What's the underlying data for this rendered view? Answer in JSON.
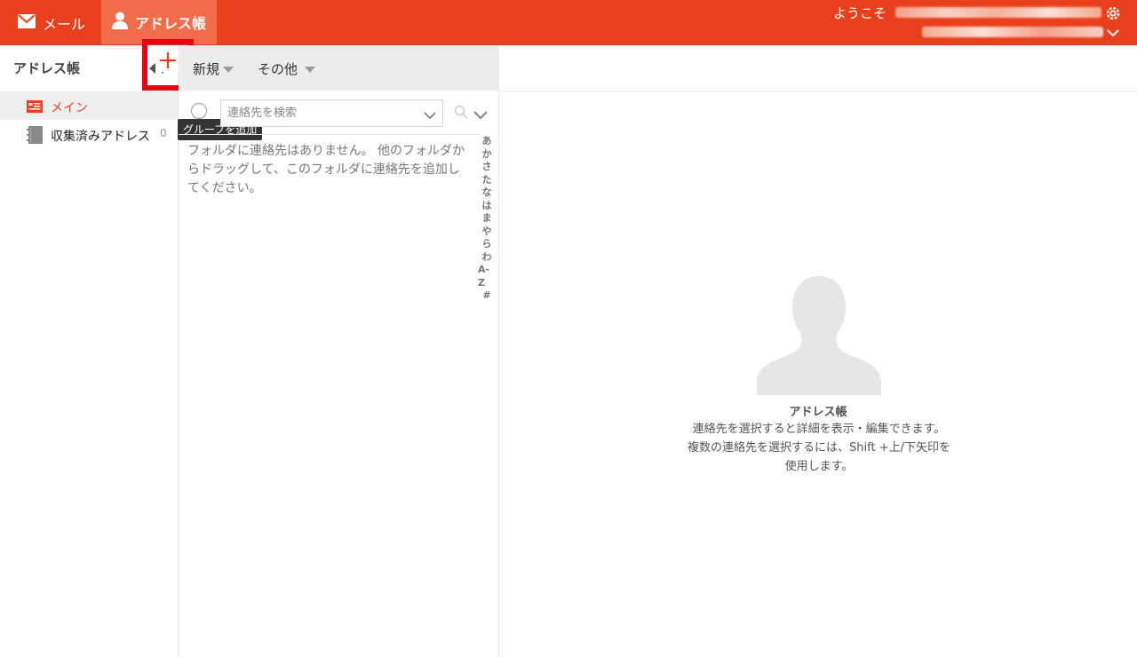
{
  "topbar": {
    "mail_tab": "メール",
    "address_tab": "アドレス帳",
    "welcome": "ようこそ",
    "icons": [
      "mail-icon",
      "person-icon",
      "gear-icon",
      "chevron-down-icon"
    ]
  },
  "left_panel": {
    "title": "アドレス帳",
    "folders": [
      {
        "label": "メイン",
        "selected": true
      },
      {
        "label": "収集済みアドレス",
        "count": "0"
      }
    ],
    "add_group_tooltip": "グループを追加"
  },
  "toolbar": {
    "new_label": "新規",
    "other_label": "その他"
  },
  "search": {
    "placeholder": "連絡先を検索"
  },
  "contact_list": {
    "empty_message": "フォルダに連絡先はありません。 他のフォルダからドラッグして、このフォルダに連絡先を追加してください。"
  },
  "alpha_index": [
    "あ",
    "か",
    "さ",
    "た",
    "な",
    "は",
    "ま",
    "や",
    "ら",
    "わ",
    "A-Z",
    "#"
  ],
  "detail": {
    "title": "アドレス帳",
    "description": "連絡先を選択すると詳細を表示・編集できます。 複数の連絡先を選択するには、Shift +上/下矢印を使用します。"
  },
  "colors": {
    "brand": "#e8401c",
    "active_tab": "#f16c4a",
    "highlight_box": "#e60012"
  }
}
